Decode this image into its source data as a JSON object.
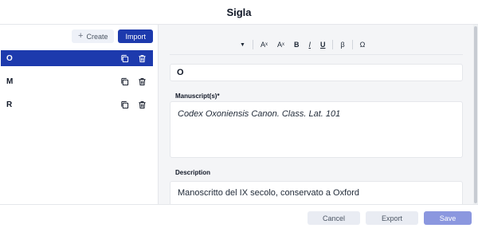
{
  "dialog": {
    "title": "Sigla"
  },
  "left_panel": {
    "create_label": "Create",
    "import_label": "Import",
    "sigla": [
      {
        "label": "O",
        "selected": true
      },
      {
        "label": "M",
        "selected": false
      },
      {
        "label": "R",
        "selected": false
      }
    ]
  },
  "toolbar": {
    "superscript": "A",
    "subscript": "A",
    "bold": "B",
    "italic": "I",
    "underline": "U",
    "beta": "β",
    "omega": "Ω"
  },
  "editor": {
    "siglum_value": "O",
    "manuscripts_label": "Manuscript(s)*",
    "manuscripts_value": "Codex Oxoniensis Canon. Class. Lat. 101",
    "description_label": "Description",
    "description_value": "Manoscritto del IX secolo, conservato a Oxford"
  },
  "footer": {
    "cancel_label": "Cancel",
    "export_label": "Export",
    "save_label": "Save"
  },
  "colors": {
    "primary": "#1d3aad",
    "save_disabled": "#8b97df",
    "secondary_button": "#e9ecf3"
  }
}
